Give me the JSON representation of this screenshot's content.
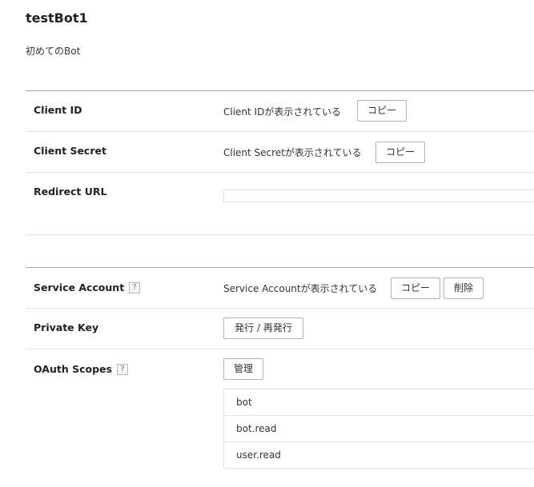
{
  "bot": {
    "name": "testBot1",
    "description": "初めてのBot"
  },
  "client_id": {
    "label": "Client ID",
    "value": "Client IDが表示されている",
    "copy_label": "コピー"
  },
  "client_secret": {
    "label": "Client Secret",
    "value": "Client Secretが表示されている",
    "copy_label": "コピー"
  },
  "redirect_url": {
    "label": "Redirect URL",
    "value": ""
  },
  "service_account": {
    "label": "Service Account",
    "help": "?",
    "value": "Service Accountが表示されている",
    "copy_label": "コピー",
    "delete_label": "削除"
  },
  "private_key": {
    "label": "Private Key",
    "issue_label": "発行 / 再発行"
  },
  "oauth_scopes": {
    "label": "OAuth Scopes",
    "help": "?",
    "manage_label": "管理",
    "scopes": [
      "bot",
      "bot.read",
      "user.read"
    ]
  }
}
